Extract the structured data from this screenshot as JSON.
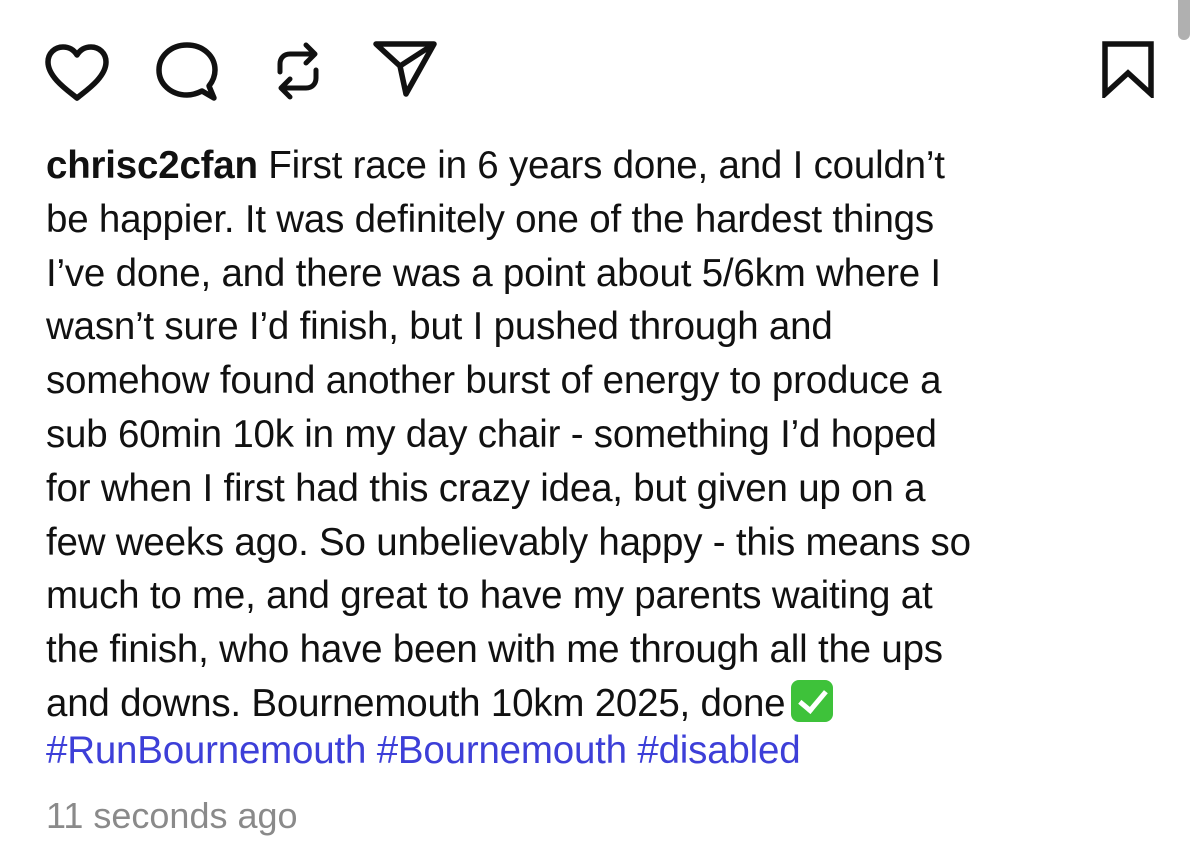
{
  "post": {
    "actions": {
      "like_icon": "heart-icon",
      "comment_icon": "comment-icon",
      "repost_icon": "repost-icon",
      "share_icon": "send-icon",
      "save_icon": "bookmark-icon"
    },
    "username": "chrisc2cfan",
    "caption_lines": [
      " First race in 6 years done, and I couldn’t",
      "be happier. It was definitely one of the hardest things",
      "I’ve done, and there was a point about 5/6km where I",
      "wasn’t sure I’d finish, but I pushed through and",
      "somehow found another burst of energy to produce a",
      "sub 60min 10k in my day chair - something I’d hoped",
      "for when I first had this crazy idea, but given up on a",
      "few weeks ago. So unbelievably happy - this means so",
      "much to me, and great to have my parents waiting at",
      "the finish, who have been with me through all the ups",
      "and downs. Bournemouth 10km 2025, done"
    ],
    "hashtags": [
      "#RunBournemouth",
      "#Bournemouth",
      "#disabled"
    ],
    "timestamp": "11 seconds ago",
    "colors": {
      "text": "#111111",
      "hashtag": "#3d3fd8",
      "timestamp": "#8a8a8a",
      "check_emoji": "#3ec23a"
    }
  }
}
